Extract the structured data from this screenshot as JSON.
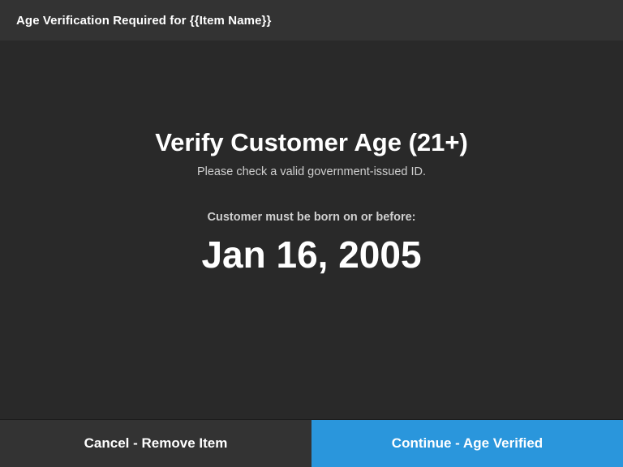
{
  "header": {
    "title": "Age Verification Required for {{Item Name}}"
  },
  "main": {
    "title": "Verify Customer Age (21+)",
    "subtitle": "Please check a valid government-issued ID.",
    "born_label": "Customer must be born on or before:",
    "date": "Jan 16, 2005"
  },
  "footer": {
    "cancel_label": "Cancel - Remove Item",
    "continue_label": "Continue - Age Verified"
  },
  "colors": {
    "background": "#292929",
    "header_bg": "#333333",
    "cancel_bg": "#333333",
    "continue_bg": "#2a96dc"
  }
}
